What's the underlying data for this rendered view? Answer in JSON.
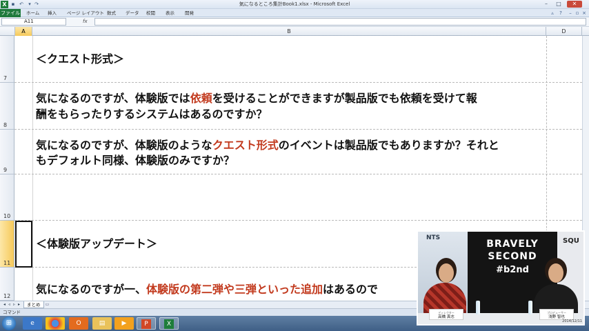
{
  "window": {
    "title": "気になるところ集計Book1.xlsx - Microsoft Excel",
    "app_icon": "X",
    "minimize": "–",
    "maximize": "□",
    "close": "✕"
  },
  "ribbon": {
    "file_tab": "ファイル",
    "tabs": [
      "ホーム",
      "挿入",
      "ページ レイアウト",
      "数式",
      "データ",
      "校閲",
      "表示",
      "開発"
    ]
  },
  "formula_bar": {
    "name_box": "A11",
    "fx": "fx",
    "formula": ""
  },
  "columns": [
    "A",
    "B",
    "D"
  ],
  "rows": [
    {
      "number": "7",
      "text_segments": [
        {
          "t": "＜クエスト形式＞",
          "red": false
        }
      ]
    },
    {
      "number": "8",
      "lines": [
        [
          {
            "t": "気になるのですが、体験版では",
            "red": false
          },
          {
            "t": "依頼",
            "red": true
          },
          {
            "t": "を受けることができますが製品版でも依頼を受けて報",
            "red": false
          }
        ],
        [
          {
            "t": "酬をもらったりするシステムはあるのですか？",
            "red": false
          }
        ]
      ]
    },
    {
      "number": "9",
      "lines": [
        [
          {
            "t": "気になるのですが、体験版のような",
            "red": false
          },
          {
            "t": "クエスト形式",
            "red": true
          },
          {
            "t": "のイベントは製品版でもありますか？それと",
            "red": false
          }
        ],
        [
          {
            "t": "もデフォルト同様、体験版のみですか？",
            "red": false
          }
        ]
      ]
    },
    {
      "number": "10"
    },
    {
      "number": "11",
      "text_segments": [
        {
          "t": "＜体験版アップデート＞",
          "red": false
        }
      ]
    },
    {
      "number": "12",
      "lines": [
        [
          {
            "t": "気になるのですが一、",
            "red": false
          },
          {
            "t": "体験版の第二弾や三弾といった追加",
            "red": true
          },
          {
            "t": "はあるので",
            "red": false
          }
        ]
      ]
    }
  ],
  "sheet_tabs": {
    "active": "まとめ"
  },
  "status_bar": {
    "text": "コマンド"
  },
  "taskbar": {
    "start": "⊞",
    "apps": [
      "IE",
      "Chrome",
      "Office",
      "Folder",
      "Media",
      "PowerPoint",
      "Excel"
    ]
  },
  "overlay": {
    "brand_line1": "BRAVELY",
    "brand_line2": "SECOND",
    "hashtag": "#b2nd",
    "left_sign": "NTS",
    "right_sign": "SQU",
    "nameplate_left": "高橋 真志",
    "nameplate_left_small": "ディレクター",
    "nameplate_right": "浅野 智也",
    "nameplate_right_small": "プロデューサー",
    "date": "2014/12/11"
  }
}
